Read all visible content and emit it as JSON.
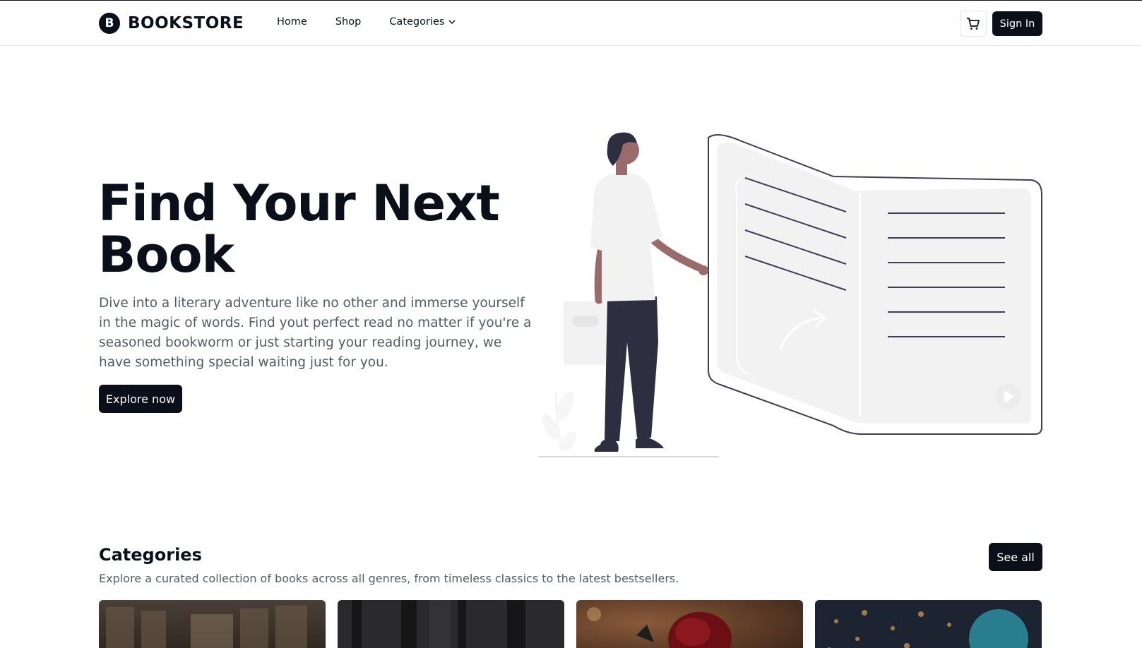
{
  "header": {
    "logo_letter": "B",
    "logo_text": "BOOKSTORE",
    "nav": [
      {
        "label": "Home"
      },
      {
        "label": "Shop"
      },
      {
        "label": "Categories",
        "icon": "chevron-down-icon"
      }
    ],
    "cart_icon": "cart-icon",
    "signin_label": "Sign In"
  },
  "hero": {
    "title": "Find Your Next Book",
    "description": "Dive into a literary adventure like no other and immerse yourself in the magic of words. Find yout perfect read no matter if you're a seasoned bookworm or just starting your reading journey, we have something special waiting just for you.",
    "cta_label": "Explore now",
    "illustration": "person-reading-open-book-illustration"
  },
  "categories": {
    "title": "Categories",
    "subtitle": "Explore a curated collection of books across all genres, from timeless classics to the latest bestsellers.",
    "see_all_label": "See all",
    "cards": [
      {
        "image": "library-shelves-photo"
      },
      {
        "image": "dark-forest-photo"
      },
      {
        "image": "red-rose-photo"
      },
      {
        "image": "night-bokeh-photo"
      }
    ]
  },
  "colors": {
    "primary": "#0b0f1a",
    "text_muted": "#555a66",
    "border": "#e8e8ec",
    "skin": "#9a6b6b",
    "pants": "#2f2e41"
  }
}
